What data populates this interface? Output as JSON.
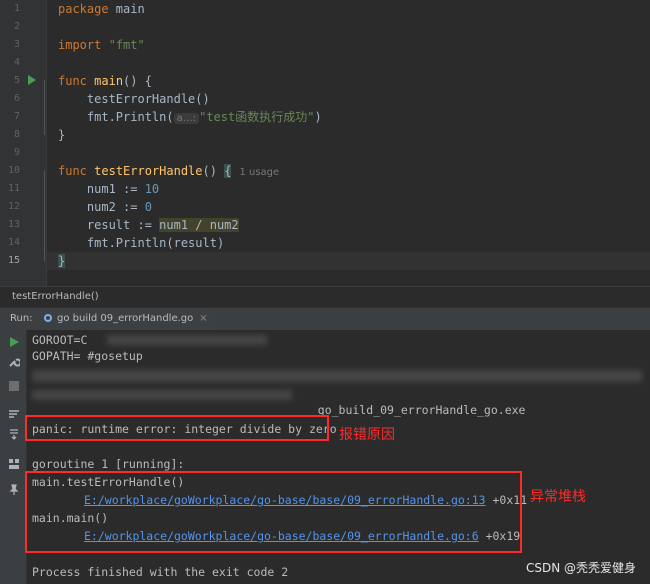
{
  "editor": {
    "lines": [
      {
        "n": "1"
      },
      {
        "n": "2"
      },
      {
        "n": "3"
      },
      {
        "n": "4"
      },
      {
        "n": "5"
      },
      {
        "n": "6"
      },
      {
        "n": "7"
      },
      {
        "n": "8"
      },
      {
        "n": "9"
      },
      {
        "n": "10"
      },
      {
        "n": "11"
      },
      {
        "n": "12"
      },
      {
        "n": "13"
      },
      {
        "n": "14"
      },
      {
        "n": "15"
      }
    ],
    "code": {
      "l1_kw": "package",
      "l1_rest": " main",
      "l3_kw": "import",
      "l3_str": "\"fmt\"",
      "l5_kw": "func",
      "l5_fn": "main",
      "l5_rest": "() {",
      "l6": "    testErrorHandle()",
      "l7_a": "    fmt.Println(",
      "l7_hint": "a…:",
      "l7_str": "\"test函数执行成功\"",
      "l7_b": ")",
      "l8": "}",
      "l10_kw": "func",
      "l10_fn": "testErrorHandle",
      "l10_rest": "() ",
      "l10_brace": "{",
      "l10_usage": "1 usage",
      "l11_a": "    num1 := ",
      "l11_num": "10",
      "l12_a": "    num2 := ",
      "l12_num": "0",
      "l13_a": "    result := ",
      "l13_sel": "num1 / num2",
      "l14": "    fmt.Println(result)",
      "l15_brace": "}"
    }
  },
  "breadcrumb": "testErrorHandle()",
  "run": {
    "label": "Run:",
    "tab": "go build 09_errorHandle.go",
    "tab_close": "×"
  },
  "console": {
    "goroot": "GOROOT=C",
    "gopath": "GOPATH= #gosetup",
    "exe": "___go_build_09_errorHandle_go.exe",
    "panic": "panic: runtime error: integer divide by zero",
    "goroutine": "goroutine 1 [running]:",
    "frame1": "main.testErrorHandle()",
    "link1": "E:/workplace/goWorkplace/go-base/base/09_errorHandle.go:13",
    "off1": " +0x11",
    "frame2": "main.main()",
    "link2": "E:/workplace/goWorkplace/go-base/base/09_errorHandle.go:6",
    "off2": " +0x19",
    "finished": "Process finished with the exit code 2"
  },
  "annotations": {
    "panic_label": "报错原因",
    "stack_label": "异常堆栈",
    "color": "#ff2b2b"
  },
  "watermark": "CSDN @秃秃爱健身"
}
